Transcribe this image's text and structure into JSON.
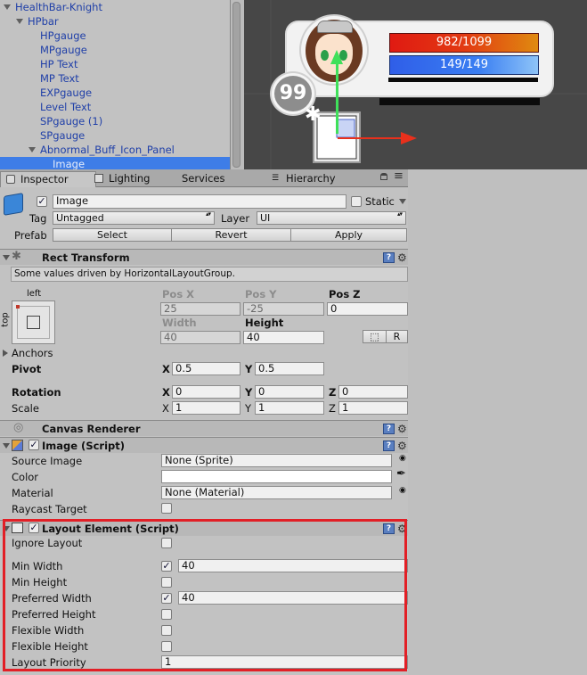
{
  "hierarchy": {
    "items": [
      {
        "label": "HealthBar-Knight"
      },
      {
        "label": "HPbar"
      },
      {
        "label": "HPgauge"
      },
      {
        "label": "MPgauge"
      },
      {
        "label": "HP Text"
      },
      {
        "label": "MP Text"
      },
      {
        "label": "EXPgauge"
      },
      {
        "label": "Level Text"
      },
      {
        "label": "SPgauge (1)"
      },
      {
        "label": "SPgauge"
      },
      {
        "label": "Abnormal_Buff_Icon_Panel"
      },
      {
        "label": "Image"
      }
    ]
  },
  "scene": {
    "hp_text": "982/1099",
    "mp_text": "149/149",
    "level": "99",
    "colors": {
      "hp": "#e01a12",
      "mp": "#2f6cf0",
      "axis_x": "#e8301c",
      "axis_y": "#3fe05a"
    }
  },
  "tabs": [
    {
      "label": "Inspector",
      "icon": "inspector-icon"
    },
    {
      "label": "Lighting",
      "icon": "lighting-icon"
    },
    {
      "label": "Services",
      "icon": "services-icon"
    },
    {
      "label": "Hierarchy",
      "icon": "hierarchy-icon"
    }
  ],
  "object": {
    "name": "Image",
    "static_label": "Static",
    "tag_label": "Tag",
    "tag_value": "Untagged",
    "layer_label": "Layer",
    "layer_value": "UI",
    "prefab_label": "Prefab",
    "select_label": "Select",
    "revert_label": "Revert",
    "apply_label": "Apply"
  },
  "rect_transform": {
    "title": "Rect Transform",
    "note": "Some values driven by HorizontalLayoutGroup.",
    "anchor_h": "left",
    "anchor_v": "top",
    "pos_x_label": "Pos X",
    "pos_x": "25",
    "pos_y_label": "Pos Y",
    "pos_y": "-25",
    "pos_z_label": "Pos Z",
    "pos_z": "0",
    "width_label": "Width",
    "width": "40",
    "height_label": "Height",
    "height": "40",
    "r_label": "R",
    "anchors_label": "Anchors",
    "pivot_label": "Pivot",
    "pivot_x": "0.5",
    "pivot_y": "0.5",
    "rotation_label": "Rotation",
    "rot_x": "0",
    "rot_y": "0",
    "rot_z": "0",
    "scale_label": "Scale",
    "scale_x": "1",
    "scale_y": "1",
    "scale_z": "1",
    "x": "X",
    "y": "Y",
    "z": "Z"
  },
  "canvas_renderer": {
    "title": "Canvas Renderer"
  },
  "image_script": {
    "title": "Image (Script)",
    "source_image_label": "Source Image",
    "source_image": "None (Sprite)",
    "color_label": "Color",
    "material_label": "Material",
    "material": "None (Material)",
    "raycast_label": "Raycast Target"
  },
  "layout_element": {
    "title": "Layout Element (Script)",
    "ignore_layout": "Ignore Layout",
    "min_width": "Min Width",
    "min_width_value": "40",
    "min_height": "Min Height",
    "preferred_width": "Preferred Width",
    "preferred_width_value": "40",
    "preferred_height": "Preferred Height",
    "flexible_width": "Flexible Width",
    "flexible_height": "Flexible Height",
    "layout_priority": "Layout Priority",
    "layout_priority_value": "1"
  }
}
